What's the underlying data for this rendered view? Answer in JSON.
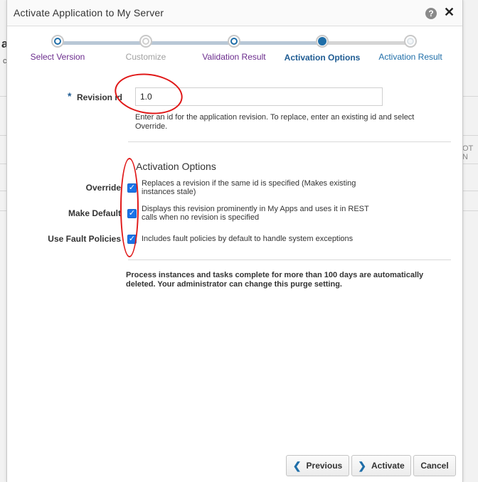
{
  "background": {
    "left_heading": "a",
    "left_sub": "c",
    "right_text": "OT N"
  },
  "dialog": {
    "title": "Activate Application to My Server",
    "help_icon": "question-mark-icon",
    "close_icon": "close-x-icon"
  },
  "steps": [
    {
      "label": "Select Version",
      "state": "visited"
    },
    {
      "label": "Customize",
      "state": "disabled"
    },
    {
      "label": "Validation Result",
      "state": "visited"
    },
    {
      "label": "Activation Options",
      "state": "current"
    },
    {
      "label": "Activation Result",
      "state": "future"
    }
  ],
  "revision": {
    "required_mark": "*",
    "label": "Revision id",
    "value": "1.0",
    "help": "Enter an id for the application revision. To replace, enter an existing id and select Override."
  },
  "activation_options": {
    "title": "Activation Options",
    "options": [
      {
        "label": "Override",
        "checked": true,
        "description": "Replaces a revision if the same id is specified (Makes existing instances stale)"
      },
      {
        "label": "Make Default",
        "checked": true,
        "description": "Displays this revision prominently in My Apps and uses it in REST calls when no revision is specified"
      },
      {
        "label": "Use Fault Policies",
        "checked": true,
        "description": "Includes fault policies by default to handle system exceptions"
      }
    ]
  },
  "purge_note": "Process instances and tasks complete for more than 100 days are automatically deleted. Your administrator can change this purge setting.",
  "buttons": {
    "previous": "Previous",
    "activate": "Activate",
    "cancel": "Cancel"
  },
  "colors": {
    "accent": "#1f6ea8",
    "annotation": "#e01818",
    "checkbox": "#1a73e8"
  }
}
